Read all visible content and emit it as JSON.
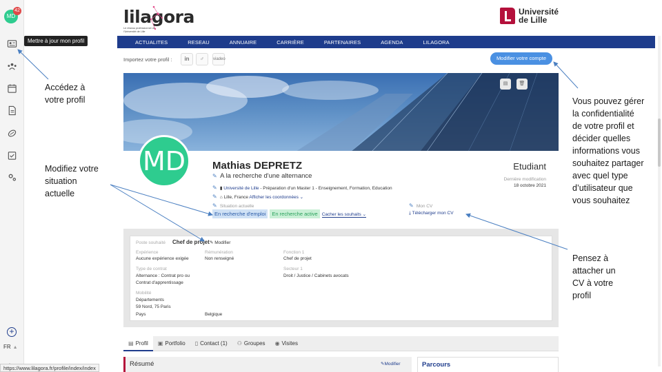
{
  "sidebar": {
    "avatar_initials": "MD",
    "notification_count": "42",
    "language": "FR",
    "icons": [
      "profile-card-icon",
      "network-icon",
      "calendar-icon",
      "document-icon",
      "handshake-icon",
      "checklist-icon",
      "settings-icon"
    ],
    "tooltip": "Mettre à jour mon profil"
  },
  "header": {
    "logo_text": "lilagora",
    "logo_tagline": "Le réseau professionnel de l'Université de Lille",
    "university_line1": "Université",
    "university_line2": "de Lille"
  },
  "nav": {
    "items": [
      "ACTUALITES",
      "RESEAU",
      "ANNUAIRE",
      "CARRIÈRE",
      "PARTENAIRES",
      "AGENDA",
      "LILAGORA"
    ]
  },
  "import": {
    "label": "Importez votre profil :",
    "buttons": [
      "in",
      "♂",
      "viadeo"
    ]
  },
  "account_button": "Modifier votre compte",
  "profile": {
    "initials": "MD",
    "name": "Mathias DEPRETZ",
    "headline": "A la recherche d'une alternance",
    "university": "Université de Lille",
    "program": " - Préparation d'un Master 1 - Enseignement, Formation, Education",
    "location": "Lille, France",
    "show_contact": "Afficher les coordonnées",
    "situation_label": "Situation actuelle",
    "pill_job": "En recherche d'emploi",
    "pill_active": "En recherche active",
    "hide_wishes": "Cacher les souhaits",
    "status": "Etudiant",
    "last_mod_label": "Dernière modification",
    "last_mod_date": "18 octobre 2021",
    "cv_label": "Mon CV",
    "cv_download": "Télécharger mon CV"
  },
  "wishes": {
    "poste_label": "Poste souhaité",
    "poste_value": "Chef de projet",
    "modify": "Modifier",
    "experience_label": "Expérience",
    "experience_value": "Aucune expérience exigée",
    "remuneration_label": "Rémunération",
    "remuneration_value": "Non renseigné",
    "fonction_label": "Fonction 1",
    "fonction_value": "Chef de projet",
    "contrat_label": "Type de contrat",
    "contrat_value1": "Alternance : Contrat pro ou",
    "contrat_value2": "Contrat d'apprentissage",
    "secteur_label": "Secteur 1",
    "secteur_value": "Droit / Justice / Cabinets avocats",
    "mobilite_label": "Mobilité",
    "departements_label": "Départements",
    "departements_value": "59 Nord, 75 Paris",
    "pays_label": "Pays",
    "pays_value": "Belgique"
  },
  "tabs": [
    "Profil",
    "Portfolio",
    "Contact (1)",
    "Groupes",
    "Visites"
  ],
  "resume": {
    "title": "Résumé",
    "modify": "Modifier"
  },
  "parcours": "Parcours",
  "status_url": "https://www.lilagora.fr/profile/index/index",
  "annotations": {
    "profile_access": [
      "Accédez à",
      "votre profil"
    ],
    "situation": [
      "Modifiez votre",
      "situation",
      "actuelle"
    ],
    "privacy": [
      "Vous pouvez gérer",
      "la confidentialité",
      "de votre profil et",
      "décider quelles",
      "informations vous",
      "souhaitez partager",
      "avec quel type",
      "d’utilisateur que",
      "vous souhaitez"
    ],
    "cv": [
      "Pensez à",
      "attacher un",
      "CV à votre",
      "profil"
    ]
  },
  "colors": {
    "brand_blue": "#1e3c8c",
    "accent_blue": "#4a90e2",
    "avatar_green": "#2ecc8f",
    "university_red": "#b4103b"
  }
}
